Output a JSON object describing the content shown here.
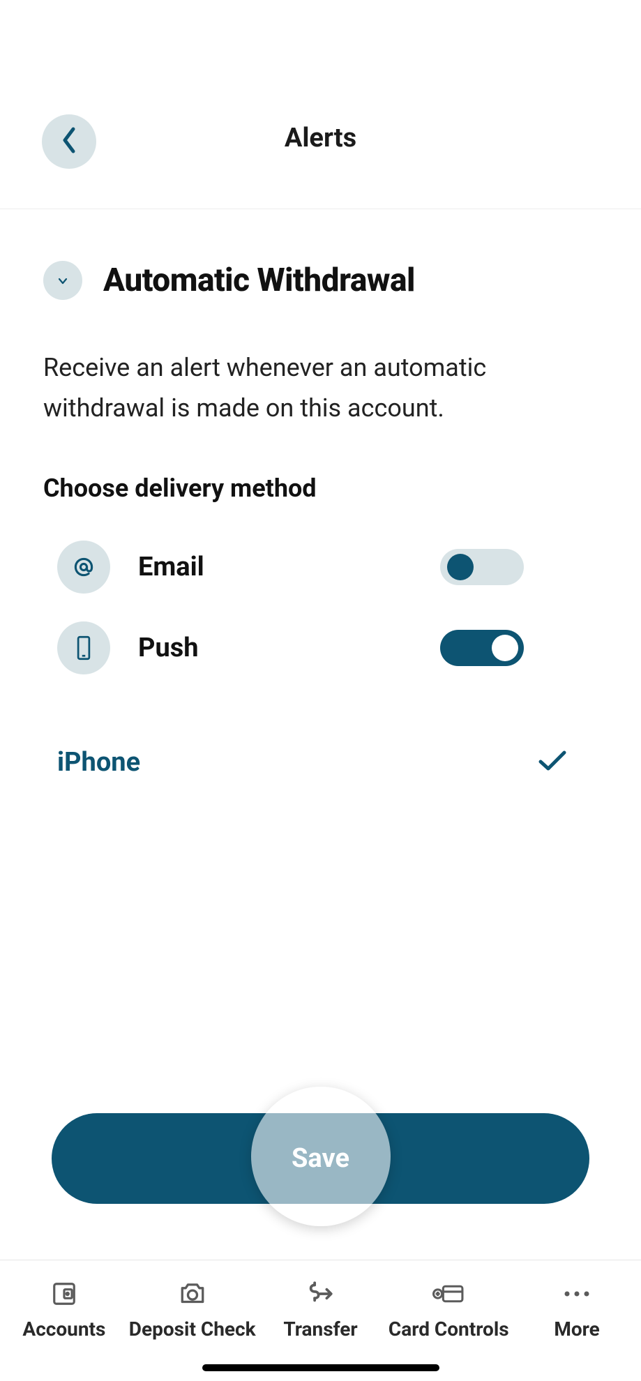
{
  "header": {
    "title": "Alerts"
  },
  "section": {
    "title": "Automatic Withdrawal",
    "description": "Receive an alert whenever an automatic withdrawal is made on this account.",
    "deliveryHeading": "Choose delivery method",
    "methods": [
      {
        "id": "email",
        "label": "Email",
        "icon": "at-sign-icon",
        "enabled": false
      },
      {
        "id": "push",
        "label": "Push",
        "icon": "smartphone-icon",
        "enabled": true
      }
    ],
    "device": {
      "name": "iPhone",
      "selected": true
    }
  },
  "actions": {
    "save": "Save"
  },
  "tabs": [
    {
      "id": "accounts",
      "label": "Accounts",
      "icon": "accounts-icon"
    },
    {
      "id": "deposit-check",
      "label": "Deposit Check",
      "icon": "camera-icon"
    },
    {
      "id": "transfer",
      "label": "Transfer",
      "icon": "transfer-icon"
    },
    {
      "id": "card-controls",
      "label": "Card Controls",
      "icon": "card-controls-icon"
    },
    {
      "id": "more",
      "label": "More",
      "icon": "more-icon"
    }
  ],
  "colors": {
    "accent": "#0d5472",
    "iconBg": "#d8e3e6"
  }
}
